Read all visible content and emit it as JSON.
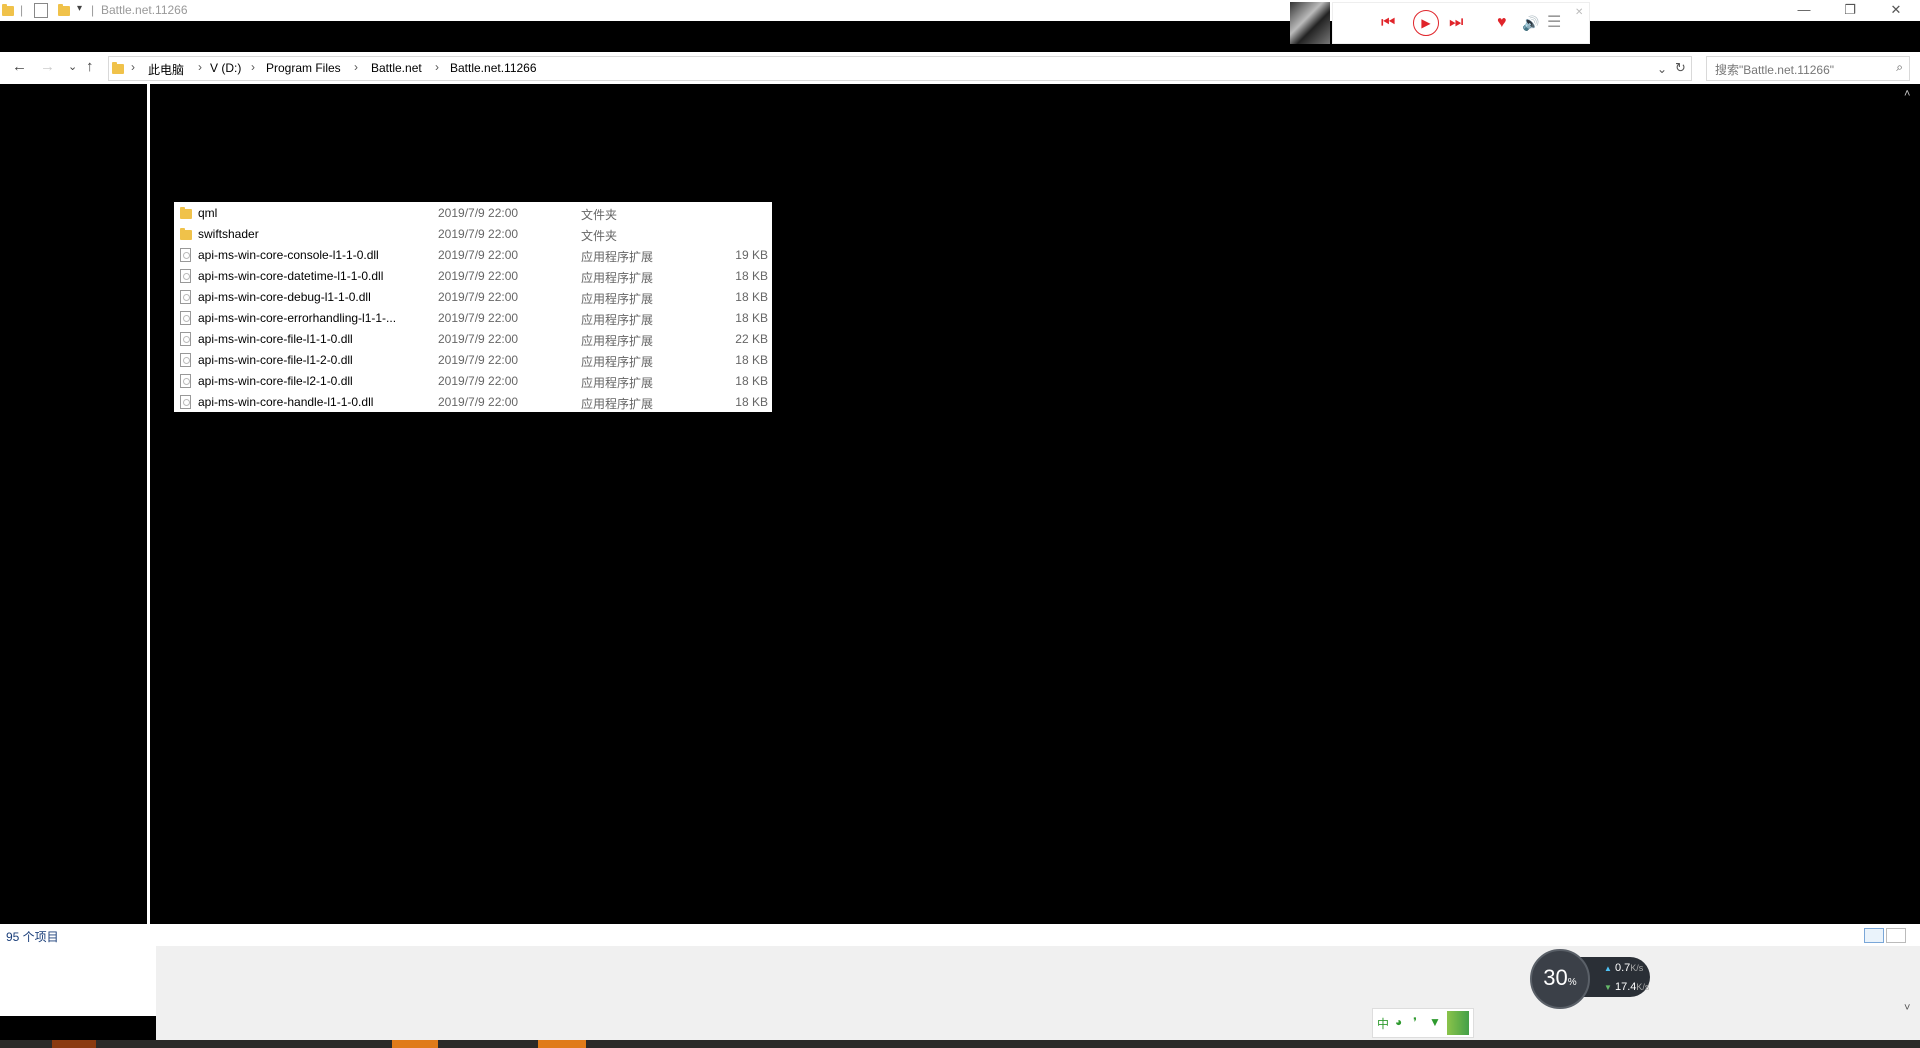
{
  "window": {
    "title": "Battle.net.11266",
    "controls": {
      "minimize": "—",
      "restore": "❐",
      "close": "✕"
    }
  },
  "nav": {
    "back": "←",
    "forward": "→",
    "recent": "⌄",
    "up": "↑",
    "refresh": "↻",
    "dropdown": "⌄"
  },
  "breadcrumb": [
    "此电脑",
    "V (D:)",
    "Program Files",
    "Battle.net",
    "Battle.net.11266"
  ],
  "search": {
    "placeholder": "搜索\"Battle.net.11266\""
  },
  "files": [
    {
      "name": "qml",
      "date": "2019/7/9 22:00",
      "type": "文件夹",
      "size": "",
      "kind": "folder"
    },
    {
      "name": "swiftshader",
      "date": "2019/7/9 22:00",
      "type": "文件夹",
      "size": "",
      "kind": "folder"
    },
    {
      "name": "api-ms-win-core-console-l1-1-0.dll",
      "date": "2019/7/9 22:00",
      "type": "应用程序扩展",
      "size": "19 KB",
      "kind": "file"
    },
    {
      "name": "api-ms-win-core-datetime-l1-1-0.dll",
      "date": "2019/7/9 22:00",
      "type": "应用程序扩展",
      "size": "18 KB",
      "kind": "file"
    },
    {
      "name": "api-ms-win-core-debug-l1-1-0.dll",
      "date": "2019/7/9 22:00",
      "type": "应用程序扩展",
      "size": "18 KB",
      "kind": "file"
    },
    {
      "name": "api-ms-win-core-errorhandling-l1-1-...",
      "date": "2019/7/9 22:00",
      "type": "应用程序扩展",
      "size": "18 KB",
      "kind": "file"
    },
    {
      "name": "api-ms-win-core-file-l1-1-0.dll",
      "date": "2019/7/9 22:00",
      "type": "应用程序扩展",
      "size": "22 KB",
      "kind": "file"
    },
    {
      "name": "api-ms-win-core-file-l1-2-0.dll",
      "date": "2019/7/9 22:00",
      "type": "应用程序扩展",
      "size": "18 KB",
      "kind": "file"
    },
    {
      "name": "api-ms-win-core-file-l2-1-0.dll",
      "date": "2019/7/9 22:00",
      "type": "应用程序扩展",
      "size": "18 KB",
      "kind": "file"
    },
    {
      "name": "api-ms-win-core-handle-l1-1-0.dll",
      "date": "2019/7/9 22:00",
      "type": "应用程序扩展",
      "size": "18 KB",
      "kind": "file"
    }
  ],
  "status": {
    "item_count": "95 个项目"
  },
  "speed_widget": {
    "percent": "30",
    "percent_unit": "%",
    "upload": "0.7",
    "upload_unit": "K/s",
    "download": "17.4",
    "download_unit": "K/s"
  },
  "ime": {
    "mode": "中"
  },
  "colors": {
    "accent": "#e07b1a",
    "folder": "#f0c24a",
    "heart": "#e0242a"
  }
}
